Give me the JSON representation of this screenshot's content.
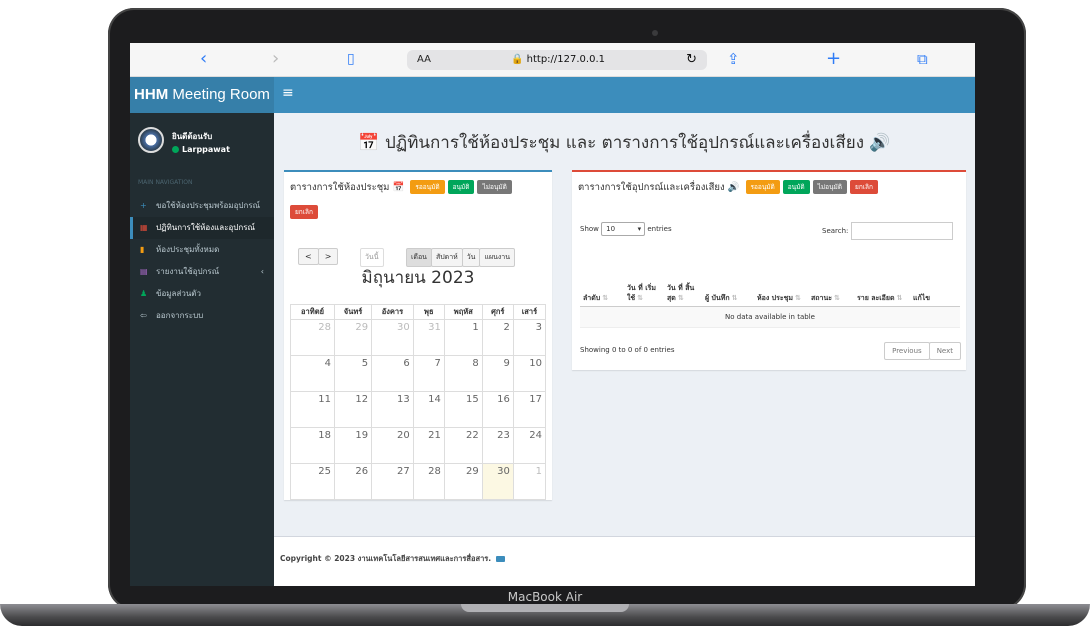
{
  "browser": {
    "back_icon": "‹",
    "forward_icon": "›",
    "book_icon": "▯",
    "aa": "AA",
    "url": "http://127.0.0.1",
    "reload_icon": "↻",
    "share_icon": "⇪",
    "plus_icon": "+",
    "tabs_icon": "⧉"
  },
  "app": {
    "brand_bold": "HHM",
    "brand_rest": " Meeting Room",
    "menu_icon": "≡"
  },
  "user": {
    "greeting": "ยินดีต้อนรับ",
    "name": "Larppawat"
  },
  "sidebar": {
    "header": "MAIN NAVIGATION",
    "items": [
      {
        "label": "ขอใช้ห้องประชุมพร้อมอุปกรณ์",
        "icon": "+",
        "color": "#3c8dbc"
      },
      {
        "label": "ปฏิทินการใช้ห้องและอุปกรณ์",
        "icon": "▦",
        "color": "#dd4b39"
      },
      {
        "label": "ห้องประชุมทั้งหมด",
        "icon": "▮",
        "color": "#f39c12"
      },
      {
        "label": "รายงานใช้อุปกรณ์",
        "icon": "▤",
        "color": "#b26dd1"
      },
      {
        "label": "ข้อมูลส่วนตัว",
        "icon": "♟",
        "color": "#00a65a"
      },
      {
        "label": "ออกจากระบบ",
        "icon": "⇦",
        "color": "#b8c7ce"
      }
    ]
  },
  "page": {
    "title": "ปฏิทินการใช้ห้องประชุม และ ตารางการใช้อุปกรณ์และเครื่องเสียง"
  },
  "left_box": {
    "title": "ตารางการใช้ห้องประชุม",
    "badges": [
      "รออนุมัติ",
      "อนุมัติ",
      "ไม่อนุมัติ",
      "ยกเลิก"
    ],
    "today": "วันนี้",
    "views": [
      "เดือน",
      "สัปดาห์",
      "วัน",
      "แผนงาน"
    ],
    "month_title": "มิถุนายน 2023",
    "weekdays": [
      "อาทิตย์",
      "จันทร์",
      "อังคาร",
      "พุธ",
      "พฤหัส",
      "ศุกร์",
      "เสาร์"
    ],
    "weeks": [
      [
        "28",
        "29",
        "30",
        "31",
        "1",
        "2",
        "3"
      ],
      [
        "4",
        "5",
        "6",
        "7",
        "8",
        "9",
        "10"
      ],
      [
        "11",
        "12",
        "13",
        "14",
        "15",
        "16",
        "17"
      ],
      [
        "18",
        "19",
        "20",
        "21",
        "22",
        "23",
        "24"
      ],
      [
        "25",
        "26",
        "27",
        "28",
        "29",
        "30",
        "1"
      ]
    ]
  },
  "right_box": {
    "title": "ตารางการใช้อุปกรณ์และเครื่องเสียง",
    "badges": [
      "รออนุมัติ",
      "อนุมัติ",
      "ไม่อนุมัติ",
      "ยกเลิก"
    ],
    "show_label": "Show",
    "entries_value": "10",
    "entries_label": "entries",
    "search_label": "Search:",
    "columns": [
      "ลำดับ",
      "วัน ที่ เริ่ม ใช้",
      "วัน ที่ สิ้น สุด",
      "ผู้ บันทึก",
      "ห้อง ประชุม",
      "สถานะ",
      "ราย ละเอียด",
      "แก้ไข"
    ],
    "empty": "No data available in table",
    "info": "Showing 0 to 0 of 0 entries",
    "prev": "Previous",
    "next": "Next"
  },
  "footer": {
    "text": "Copyright © 2023 งานเทคโนโลยีสารสนเทศและการสื่อสาร."
  },
  "device": {
    "model": "MacBook Air"
  }
}
